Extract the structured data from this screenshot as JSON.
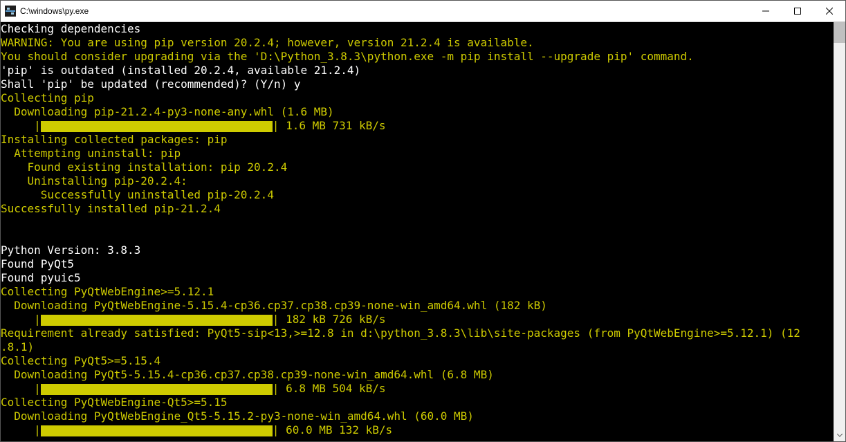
{
  "window": {
    "title": "C:\\windows\\py.exe"
  },
  "console": {
    "lines": [
      {
        "text": "Checking dependencies",
        "cls": "white"
      },
      {
        "text": "WARNING: You are using pip version 20.2.4; however, version 21.2.4 is available."
      },
      {
        "text": "You should consider upgrading via the 'D:\\Python_3.8.3\\python.exe -m pip install --upgrade pip' command."
      },
      {
        "text": "'pip' is outdated (installed 20.2.4, available 21.2.4)",
        "cls": "white"
      },
      {
        "text": "Shall 'pip' be updated (recommended)? (Y/n) y",
        "cls": "white"
      },
      {
        "text": "Collecting pip"
      },
      {
        "text": "  Downloading pip-21.2.4-py3-none-any.whl (1.6 MB)"
      },
      {
        "prefix": "     |",
        "bar": true,
        "suffix": "| 1.6 MB 731 kB/s"
      },
      {
        "text": "Installing collected packages: pip"
      },
      {
        "text": "  Attempting uninstall: pip"
      },
      {
        "text": "    Found existing installation: pip 20.2.4"
      },
      {
        "text": "    Uninstalling pip-20.2.4:"
      },
      {
        "text": "      Successfully uninstalled pip-20.2.4"
      },
      {
        "text": "Successfully installed pip-21.2.4"
      },
      {
        "text": ""
      },
      {
        "text": ""
      },
      {
        "text": "Python Version: 3.8.3",
        "cls": "white"
      },
      {
        "text": "Found PyQt5",
        "cls": "white"
      },
      {
        "text": "Found pyuic5",
        "cls": "white"
      },
      {
        "text": "Collecting PyQtWebEngine>=5.12.1"
      },
      {
        "text": "  Downloading PyQtWebEngine-5.15.4-cp36.cp37.cp38.cp39-none-win_amd64.whl (182 kB)"
      },
      {
        "prefix": "     |",
        "bar": true,
        "suffix": "| 182 kB 726 kB/s"
      },
      {
        "text": "Requirement already satisfied: PyQt5-sip<13,>=12.8 in d:\\python_3.8.3\\lib\\site-packages (from PyQtWebEngine>=5.12.1) (12"
      },
      {
        "text": ".8.1)"
      },
      {
        "text": "Collecting PyQt5>=5.15.4"
      },
      {
        "text": "  Downloading PyQt5-5.15.4-cp36.cp37.cp38.cp39-none-win_amd64.whl (6.8 MB)"
      },
      {
        "prefix": "     |",
        "bar": true,
        "suffix": "| 6.8 MB 504 kB/s"
      },
      {
        "text": "Collecting PyQtWebEngine-Qt5>=5.15"
      },
      {
        "text": "  Downloading PyQtWebEngine_Qt5-5.15.2-py3-none-win_amd64.whl (60.0 MB)"
      },
      {
        "prefix": "     |",
        "bar": true,
        "suffix": "| 60.0 MB 132 kB/s"
      }
    ]
  }
}
